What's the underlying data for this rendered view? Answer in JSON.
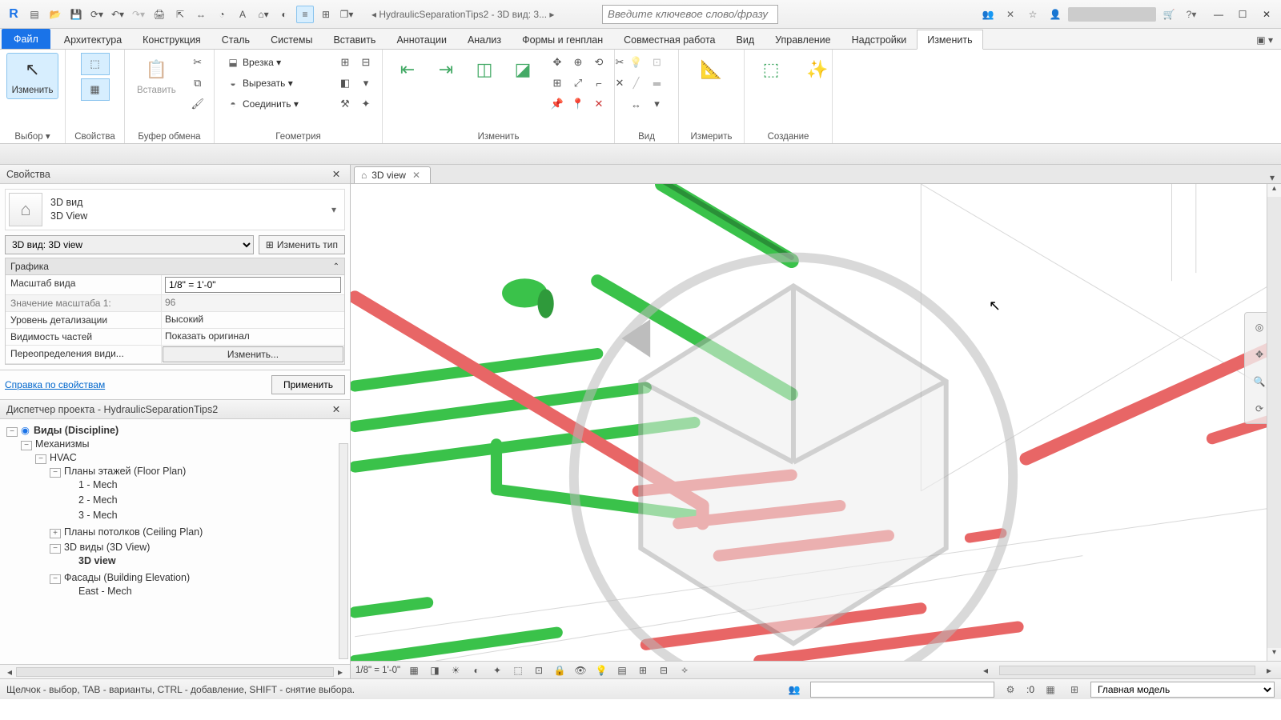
{
  "titlebar": {
    "doc_title": "HydraulicSeparationTips2 - 3D вид: 3...",
    "search_placeholder": "Введите ключевое слово/фразу"
  },
  "ribbon_tabs": {
    "file": "Файл",
    "items": [
      "Архитектура",
      "Конструкция",
      "Сталь",
      "Системы",
      "Вставить",
      "Аннотации",
      "Анализ",
      "Формы и генплан",
      "Совместная работа",
      "Вид",
      "Управление",
      "Надстройки",
      "Изменить"
    ],
    "active": "Изменить"
  },
  "ribbon_panels": {
    "select_label": "Выбор ▾",
    "modify_btn": "Изменить",
    "properties_label": "Свойства",
    "clipboard_label": "Буфер обмена",
    "paste_btn": "Вставить",
    "geometry_label": "Геометрия",
    "geom_cut_in": "Врезка ▾",
    "geom_cut": "Вырезать ▾",
    "geom_join": "Соединить ▾",
    "modify_label": "Изменить",
    "view_label": "Вид",
    "measure_label": "Измерить",
    "create_label": "Создание"
  },
  "view_tab": {
    "name": "3D view"
  },
  "properties": {
    "title": "Свойства",
    "type_line1": "3D вид",
    "type_line2": "3D View",
    "filter_value": "3D вид: 3D view",
    "edit_type": "Изменить тип",
    "group_graphics": "Графика",
    "rows": {
      "scale_k": "Масштаб вида",
      "scale_v": "1/8\" = 1'-0\"",
      "scale_val_k": "Значение масштаба    1:",
      "scale_val_v": "96",
      "detail_k": "Уровень детализации",
      "detail_v": "Высокий",
      "parts_k": "Видимость частей",
      "parts_v": "Показать оригинал",
      "vg_k": "Переопределения види...",
      "vg_v": "Изменить..."
    },
    "help_link": "Справка по свойствам",
    "apply": "Применить"
  },
  "browser": {
    "title_prefix": "Диспетчер проекта - ",
    "title_doc": "HydraulicSeparationTips2",
    "root": "Виды (Discipline)",
    "mech": "Механизмы",
    "hvac": "HVAC",
    "floor_plans": "Планы этажей (Floor Plan)",
    "fp1": "1 - Mech",
    "fp2": "2 - Mech",
    "fp3": "3 - Mech",
    "ceiling": "Планы потолков (Ceiling Plan)",
    "views3d": "3D виды (3D View)",
    "view3d_item": "3D view",
    "elev": "Фасады (Building Elevation)",
    "elev_east": "East - Mech"
  },
  "view_ctrl": {
    "scale": "1/8\" = 1'-0\""
  },
  "status": {
    "hint": "Щелчок - выбор, TAB - варианты, CTRL - добавление, SHIFT - снятие выбора.",
    "sel_count": ":0",
    "workset": "Главная модель"
  }
}
